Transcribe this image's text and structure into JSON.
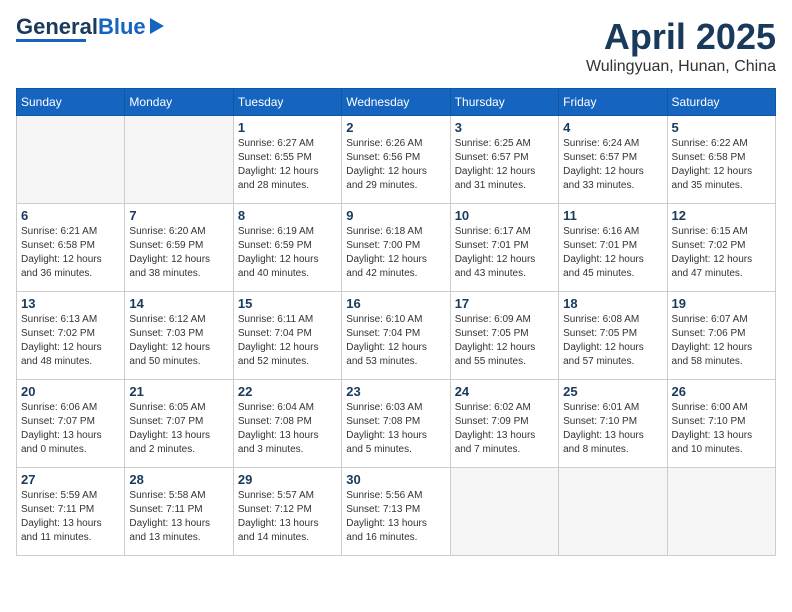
{
  "header": {
    "logo_general": "General",
    "logo_blue": "Blue",
    "month_title": "April 2025",
    "location": "Wulingyuan, Hunan, China"
  },
  "calendar": {
    "days_of_week": [
      "Sunday",
      "Monday",
      "Tuesday",
      "Wednesday",
      "Thursday",
      "Friday",
      "Saturday"
    ],
    "weeks": [
      [
        {
          "day": "",
          "info": ""
        },
        {
          "day": "",
          "info": ""
        },
        {
          "day": "1",
          "info": "Sunrise: 6:27 AM\nSunset: 6:55 PM\nDaylight: 12 hours\nand 28 minutes."
        },
        {
          "day": "2",
          "info": "Sunrise: 6:26 AM\nSunset: 6:56 PM\nDaylight: 12 hours\nand 29 minutes."
        },
        {
          "day": "3",
          "info": "Sunrise: 6:25 AM\nSunset: 6:57 PM\nDaylight: 12 hours\nand 31 minutes."
        },
        {
          "day": "4",
          "info": "Sunrise: 6:24 AM\nSunset: 6:57 PM\nDaylight: 12 hours\nand 33 minutes."
        },
        {
          "day": "5",
          "info": "Sunrise: 6:22 AM\nSunset: 6:58 PM\nDaylight: 12 hours\nand 35 minutes."
        }
      ],
      [
        {
          "day": "6",
          "info": "Sunrise: 6:21 AM\nSunset: 6:58 PM\nDaylight: 12 hours\nand 36 minutes."
        },
        {
          "day": "7",
          "info": "Sunrise: 6:20 AM\nSunset: 6:59 PM\nDaylight: 12 hours\nand 38 minutes."
        },
        {
          "day": "8",
          "info": "Sunrise: 6:19 AM\nSunset: 6:59 PM\nDaylight: 12 hours\nand 40 minutes."
        },
        {
          "day": "9",
          "info": "Sunrise: 6:18 AM\nSunset: 7:00 PM\nDaylight: 12 hours\nand 42 minutes."
        },
        {
          "day": "10",
          "info": "Sunrise: 6:17 AM\nSunset: 7:01 PM\nDaylight: 12 hours\nand 43 minutes."
        },
        {
          "day": "11",
          "info": "Sunrise: 6:16 AM\nSunset: 7:01 PM\nDaylight: 12 hours\nand 45 minutes."
        },
        {
          "day": "12",
          "info": "Sunrise: 6:15 AM\nSunset: 7:02 PM\nDaylight: 12 hours\nand 47 minutes."
        }
      ],
      [
        {
          "day": "13",
          "info": "Sunrise: 6:13 AM\nSunset: 7:02 PM\nDaylight: 12 hours\nand 48 minutes."
        },
        {
          "day": "14",
          "info": "Sunrise: 6:12 AM\nSunset: 7:03 PM\nDaylight: 12 hours\nand 50 minutes."
        },
        {
          "day": "15",
          "info": "Sunrise: 6:11 AM\nSunset: 7:04 PM\nDaylight: 12 hours\nand 52 minutes."
        },
        {
          "day": "16",
          "info": "Sunrise: 6:10 AM\nSunset: 7:04 PM\nDaylight: 12 hours\nand 53 minutes."
        },
        {
          "day": "17",
          "info": "Sunrise: 6:09 AM\nSunset: 7:05 PM\nDaylight: 12 hours\nand 55 minutes."
        },
        {
          "day": "18",
          "info": "Sunrise: 6:08 AM\nSunset: 7:05 PM\nDaylight: 12 hours\nand 57 minutes."
        },
        {
          "day": "19",
          "info": "Sunrise: 6:07 AM\nSunset: 7:06 PM\nDaylight: 12 hours\nand 58 minutes."
        }
      ],
      [
        {
          "day": "20",
          "info": "Sunrise: 6:06 AM\nSunset: 7:07 PM\nDaylight: 13 hours\nand 0 minutes."
        },
        {
          "day": "21",
          "info": "Sunrise: 6:05 AM\nSunset: 7:07 PM\nDaylight: 13 hours\nand 2 minutes."
        },
        {
          "day": "22",
          "info": "Sunrise: 6:04 AM\nSunset: 7:08 PM\nDaylight: 13 hours\nand 3 minutes."
        },
        {
          "day": "23",
          "info": "Sunrise: 6:03 AM\nSunset: 7:08 PM\nDaylight: 13 hours\nand 5 minutes."
        },
        {
          "day": "24",
          "info": "Sunrise: 6:02 AM\nSunset: 7:09 PM\nDaylight: 13 hours\nand 7 minutes."
        },
        {
          "day": "25",
          "info": "Sunrise: 6:01 AM\nSunset: 7:10 PM\nDaylight: 13 hours\nand 8 minutes."
        },
        {
          "day": "26",
          "info": "Sunrise: 6:00 AM\nSunset: 7:10 PM\nDaylight: 13 hours\nand 10 minutes."
        }
      ],
      [
        {
          "day": "27",
          "info": "Sunrise: 5:59 AM\nSunset: 7:11 PM\nDaylight: 13 hours\nand 11 minutes."
        },
        {
          "day": "28",
          "info": "Sunrise: 5:58 AM\nSunset: 7:11 PM\nDaylight: 13 hours\nand 13 minutes."
        },
        {
          "day": "29",
          "info": "Sunrise: 5:57 AM\nSunset: 7:12 PM\nDaylight: 13 hours\nand 14 minutes."
        },
        {
          "day": "30",
          "info": "Sunrise: 5:56 AM\nSunset: 7:13 PM\nDaylight: 13 hours\nand 16 minutes."
        },
        {
          "day": "",
          "info": ""
        },
        {
          "day": "",
          "info": ""
        },
        {
          "day": "",
          "info": ""
        }
      ]
    ]
  }
}
